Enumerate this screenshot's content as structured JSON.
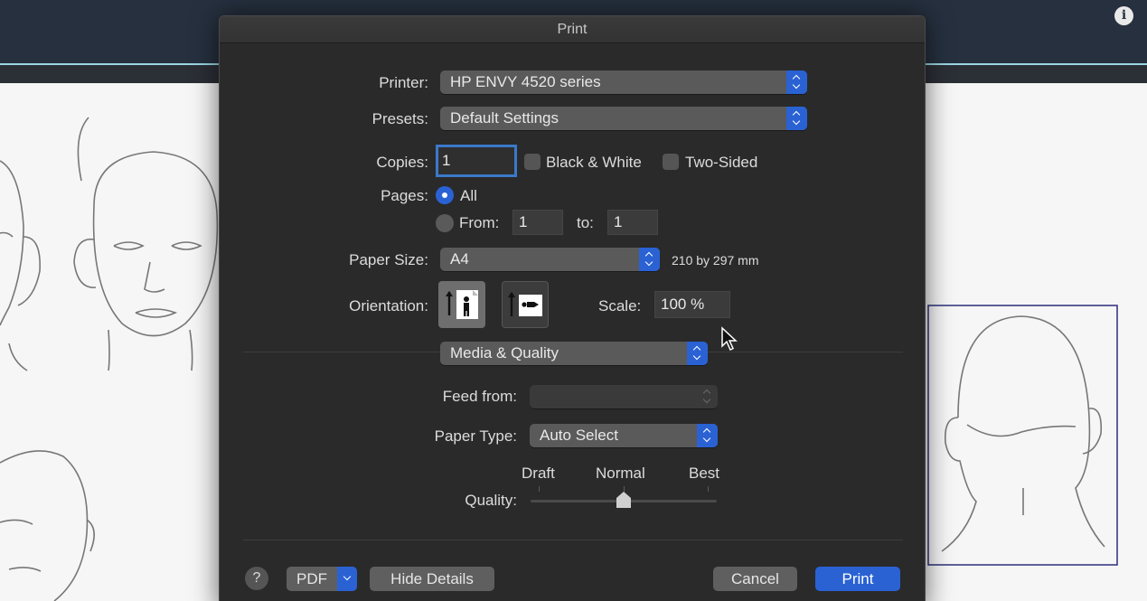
{
  "dialog": {
    "title": "Print",
    "printer": {
      "label": "Printer:",
      "value": "HP ENVY 4520 series"
    },
    "presets": {
      "label": "Presets:",
      "value": "Default Settings"
    },
    "copies": {
      "label": "Copies:",
      "value": "1",
      "black_white": "Black & White",
      "two_sided": "Two-Sided"
    },
    "pages": {
      "label": "Pages:",
      "all": "All",
      "from": "From:",
      "from_value": "1",
      "to": "to:",
      "to_value": "1",
      "selected": "All"
    },
    "paper_size": {
      "label": "Paper Size:",
      "value": "A4",
      "dims": "210 by 297 mm"
    },
    "orientation": {
      "label": "Orientation:",
      "selected": "portrait"
    },
    "scale": {
      "label": "Scale:",
      "value": "100 %"
    },
    "section": {
      "value": "Media & Quality"
    },
    "feed_from": {
      "label": "Feed from:",
      "value": ""
    },
    "paper_type": {
      "label": "Paper Type:",
      "value": "Auto Select"
    },
    "quality": {
      "label": "Quality:",
      "draft": "Draft",
      "normal": "Normal",
      "best": "Best",
      "selected": "Normal"
    },
    "buttons": {
      "help": "?",
      "pdf": "PDF",
      "hide_details": "Hide Details",
      "cancel": "Cancel",
      "print": "Print"
    }
  },
  "background": {
    "info_icon": "i"
  },
  "colors": {
    "accent": "#2a62d4",
    "dialog_bg": "#2a2a2a",
    "topbar": "#26303f"
  }
}
